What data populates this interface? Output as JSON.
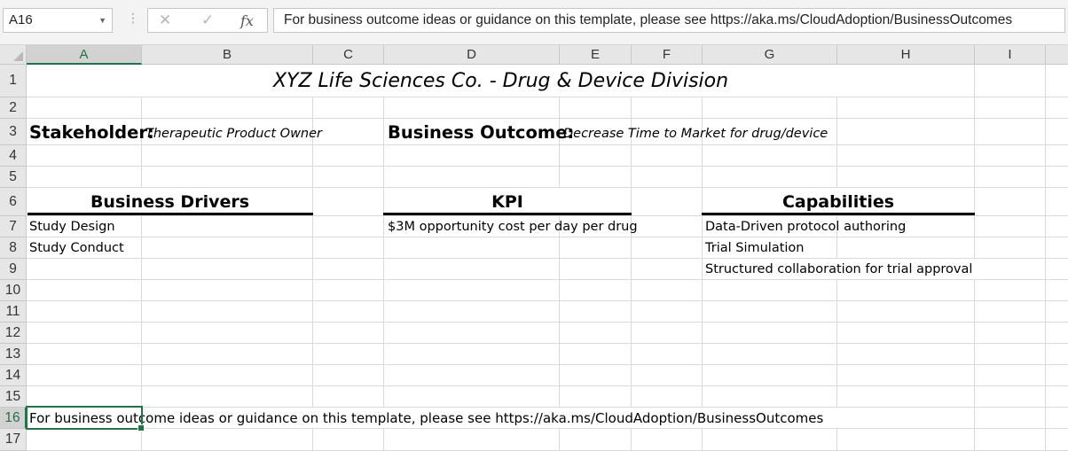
{
  "formula_bar": {
    "name_box": "A16",
    "cancel_icon": "✕",
    "enter_icon": "✓",
    "fx_label": "fx",
    "formula": "For business outcome ideas or guidance on this template, please see https://aka.ms/CloudAdoption/BusinessOutcomes"
  },
  "columns": [
    "A",
    "B",
    "C",
    "D",
    "E",
    "F",
    "G",
    "H",
    "I"
  ],
  "rows": [
    "1",
    "2",
    "3",
    "4",
    "5",
    "6",
    "7",
    "8",
    "9",
    "10",
    "11",
    "12",
    "13",
    "14",
    "15",
    "16",
    "17"
  ],
  "selected_cell": "A16",
  "sheet": {
    "title": "XYZ Life Sciences Co. - Drug & Device Division",
    "stakeholder_label": "Stakeholder:",
    "stakeholder_value": "Therapeutic Product Owner",
    "outcome_label": "Business Outcome:",
    "outcome_value": "Decrease Time to Market for drug/device",
    "drivers_header": "Business Drivers",
    "kpi_header": "KPI",
    "capabilities_header": "Capabilities",
    "drivers": [
      "Study Design",
      "Study Conduct"
    ],
    "kpis": [
      "$3M opportunity cost per day per drug"
    ],
    "capabilities": [
      "Data-Driven protocol authoring",
      "Trial Simulation",
      "Structured collaboration for trial approval"
    ],
    "footer_note": "For business outcome ideas or guidance on this template, please see https://aka.ms/CloudAdoption/BusinessOutcomes"
  }
}
